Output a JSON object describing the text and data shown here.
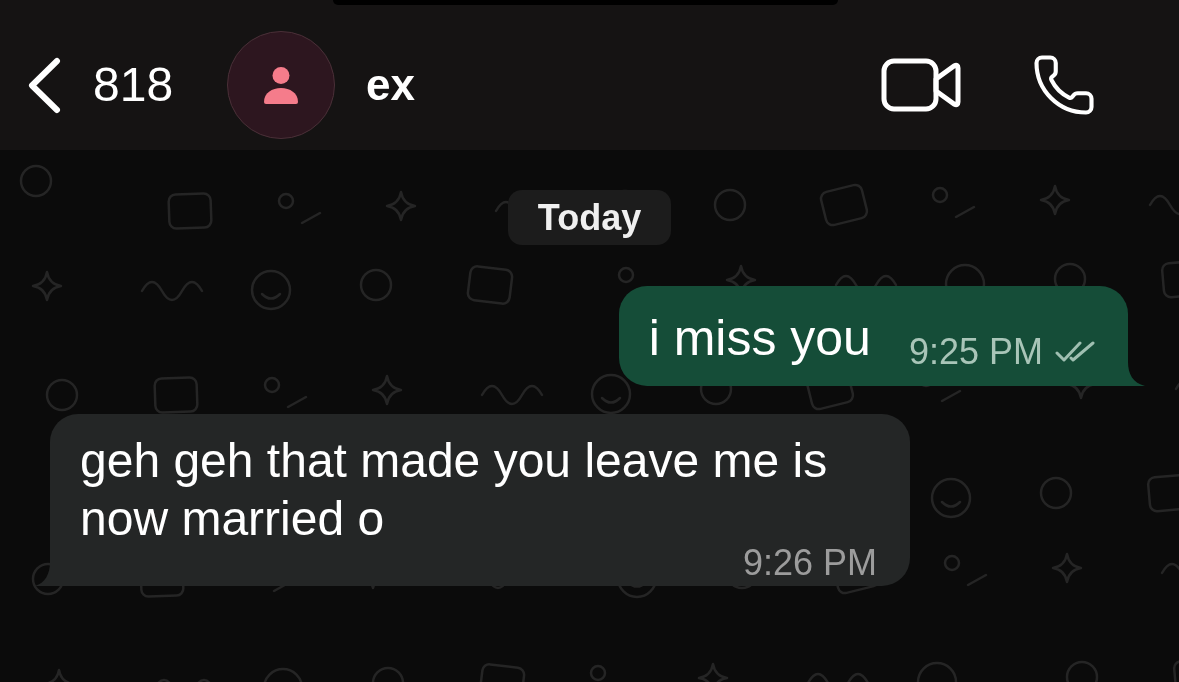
{
  "header": {
    "back_count": "818",
    "contact_name": "ex"
  },
  "date_divider": "Today",
  "messages": [
    {
      "kind": "outgoing",
      "text": "i miss you",
      "time": "9:25 PM",
      "read": false
    },
    {
      "kind": "incoming",
      "text": "geh geh that made you leave me is now married o",
      "time": "9:26 PM"
    }
  ]
}
